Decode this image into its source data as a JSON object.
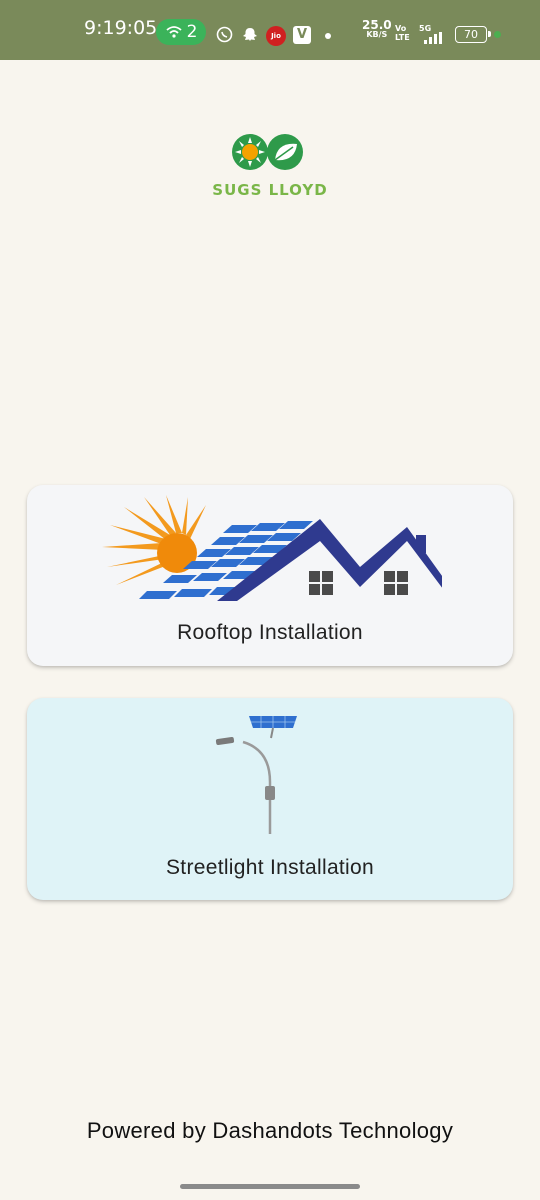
{
  "status_bar": {
    "time": "9:19:05",
    "hotspot_count": "2",
    "net_speed_value": "25.0",
    "net_speed_unit": "KB/S",
    "volte_line1": "Vo",
    "volte_line2": "LTE",
    "network_type": "5G",
    "battery_level": "70",
    "icons": [
      "hotspot-icon",
      "whatsapp-icon",
      "snapchat-icon",
      "jio-icon",
      "v-app-icon",
      "notification-dot-icon",
      "signal-icon",
      "battery-icon"
    ]
  },
  "brand": {
    "name": "SUGS LLOYD",
    "color": "#7ab648",
    "logo_icons": [
      "sun-icon",
      "leaf-icon"
    ]
  },
  "cards": [
    {
      "label": "Rooftop Installation",
      "icon": "rooftop-solar-icon",
      "background": "#f5f6f8"
    },
    {
      "label": "Streetlight Installation",
      "icon": "solar-streetlight-icon",
      "background": "#dff3f7"
    }
  ],
  "footer": {
    "powered_by": "Powered by Dashandots Technology"
  }
}
